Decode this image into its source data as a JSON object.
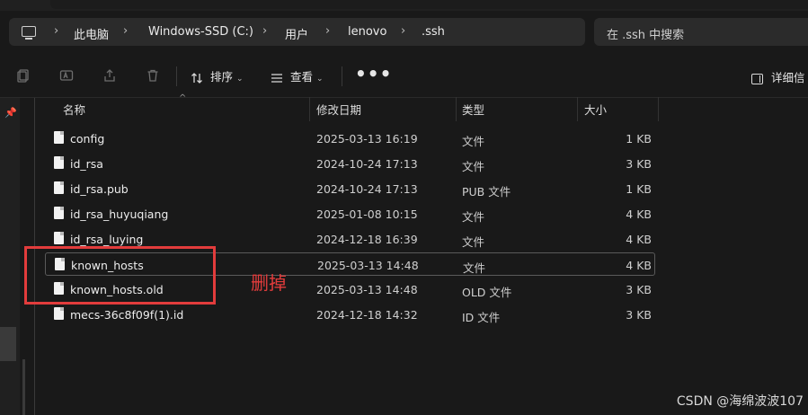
{
  "address": {
    "crumbs": [
      "此电脑",
      "Windows-SSD (C:)",
      "用户",
      "lenovo",
      ".ssh"
    ]
  },
  "search": {
    "placeholder": "在 .ssh 中搜索"
  },
  "toolbar": {
    "sort_label": "排序",
    "view_label": "查看",
    "more_label": "•••",
    "details_label": "详细信"
  },
  "columns": {
    "name": "名称",
    "date": "修改日期",
    "type": "类型",
    "size": "大小"
  },
  "files": [
    {
      "name": "config",
      "date": "2025-03-13 16:19",
      "type": "文件",
      "size": "1 KB"
    },
    {
      "name": "id_rsa",
      "date": "2024-10-24 17:13",
      "type": "文件",
      "size": "3 KB"
    },
    {
      "name": "id_rsa.pub",
      "date": "2024-10-24 17:13",
      "type": "PUB 文件",
      "size": "1 KB"
    },
    {
      "name": "id_rsa_huyuqiang",
      "date": "2025-01-08 10:15",
      "type": "文件",
      "size": "4 KB"
    },
    {
      "name": "id_rsa_luying",
      "date": "2024-12-18 16:39",
      "type": "文件",
      "size": "4 KB"
    },
    {
      "name": "known_hosts",
      "date": "2025-03-13 14:48",
      "type": "文件",
      "size": "4 KB"
    },
    {
      "name": "known_hosts.old",
      "date": "2025-03-13 14:48",
      "type": "OLD 文件",
      "size": "3 KB"
    },
    {
      "name": "mecs-36c8f09f(1).id",
      "date": "2024-12-18 14:32",
      "type": "ID 文件",
      "size": "3 KB"
    }
  ],
  "annotation": {
    "text": "删掉",
    "color": "#e23c3c"
  },
  "watermark": "CSDN @海绵波波107"
}
